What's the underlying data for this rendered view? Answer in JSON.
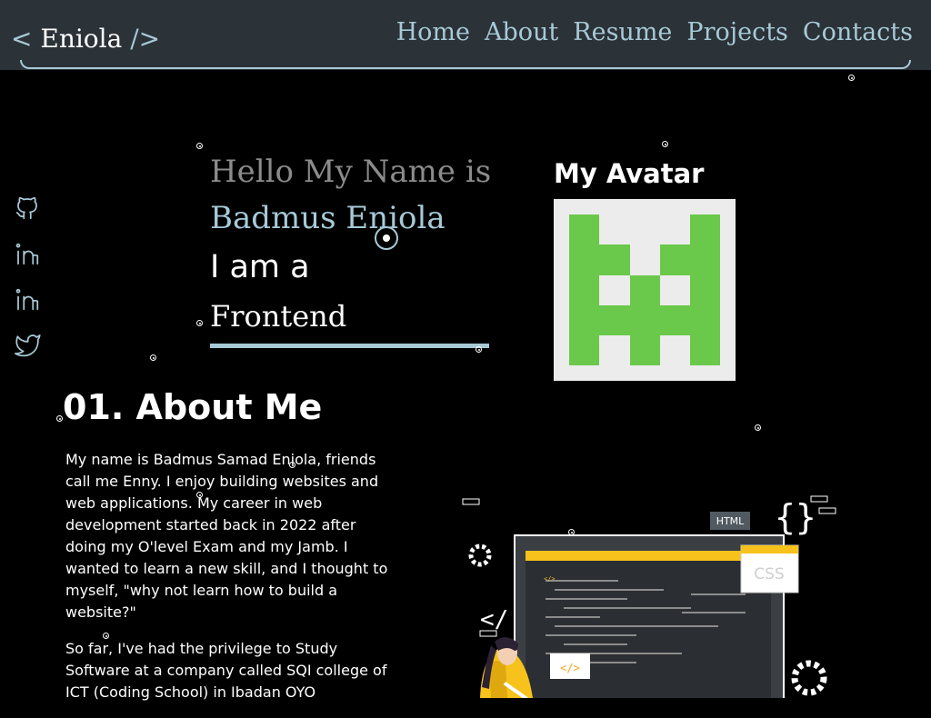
{
  "nav": {
    "brand_open": "<",
    "brand_name": "Eniola",
    "brand_close": "/>",
    "links": [
      "Home",
      "About",
      "Resume",
      "Projects",
      "Contacts"
    ]
  },
  "social": [
    "github-icon",
    "linkedin-icon",
    "linkedin-icon",
    "twitter-icon"
  ],
  "hero": {
    "greeting": "Hello My Name is",
    "name": "Badmus Eniola",
    "iam": "I am a",
    "role": "Frontend"
  },
  "avatar": {
    "title": "My Avatar"
  },
  "about": {
    "title": "01. About Me",
    "paragraphs": [
      "My name is Badmus Samad Eniola, friends call me Enny. I enjoy building websites and web applications. My career in web development started back in 2022 after doing my O'level Exam and my Jamb. I wanted to learn a new skill, and I thought to myself, \"why not learn how to build a website?\"",
      "So far, I've had the privilege to Study Software at a company called SQI college of ICT (Coding School) in Ibadan OYO"
    ]
  },
  "illustration": {
    "html_label": "HTML",
    "css_label": "CSS",
    "code_tag": "</>"
  },
  "colors": {
    "accent": "#a7c9d6",
    "navbar": "#2b3238",
    "avatar_green": "#6ac94a",
    "yellow": "#f7c21b"
  }
}
